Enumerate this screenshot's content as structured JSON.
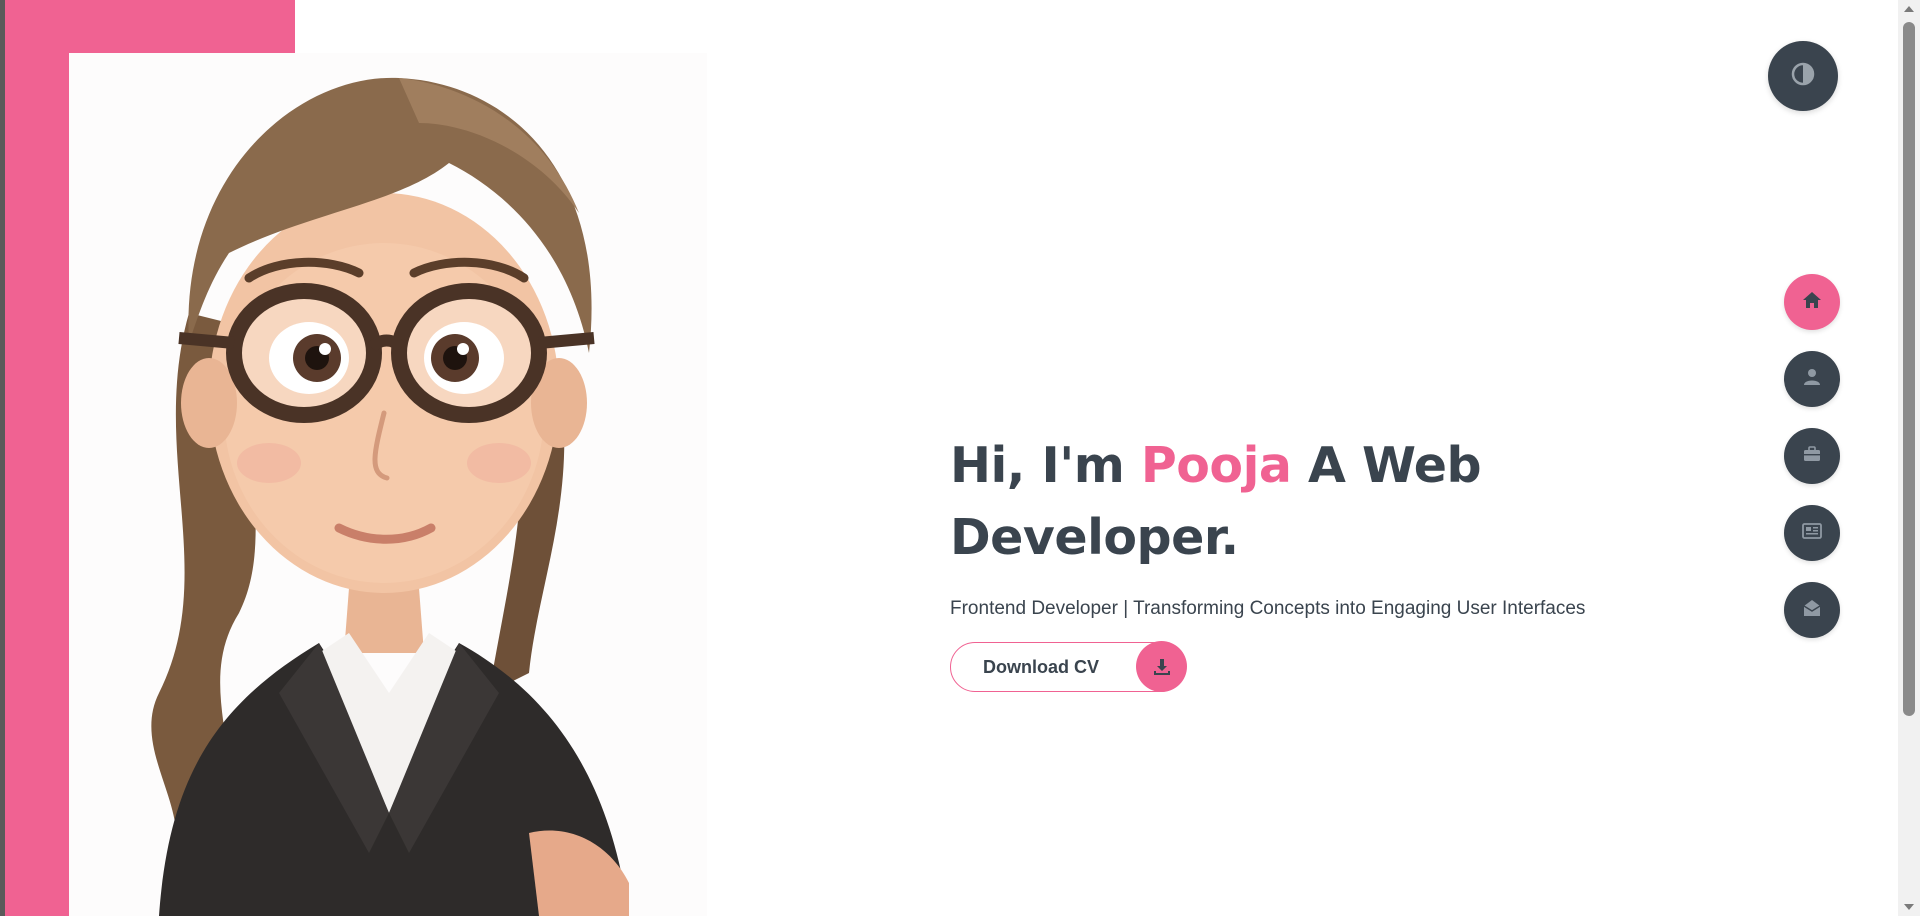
{
  "hero": {
    "title_prefix": "Hi, I'm ",
    "title_name": "Pooja",
    "title_suffix_line1": " A Web",
    "title_line2": "Developer.",
    "subtitle": "Frontend Developer | Transforming Concepts into Engaging User Interfaces",
    "cv_button_label": "Download CV",
    "cv_button_icon": "download-icon"
  },
  "theme_toggle": {
    "icon": "contrast-icon"
  },
  "nav": {
    "items": [
      {
        "icon": "home-icon",
        "active": true
      },
      {
        "icon": "user-icon",
        "active": false
      },
      {
        "icon": "briefcase-icon",
        "active": false
      },
      {
        "icon": "newspaper-icon",
        "active": false
      },
      {
        "icon": "envelope-open-icon",
        "active": false
      }
    ]
  },
  "colors": {
    "accent": "#f06292",
    "text_dark": "#3a444e",
    "background": "#ffffff"
  }
}
